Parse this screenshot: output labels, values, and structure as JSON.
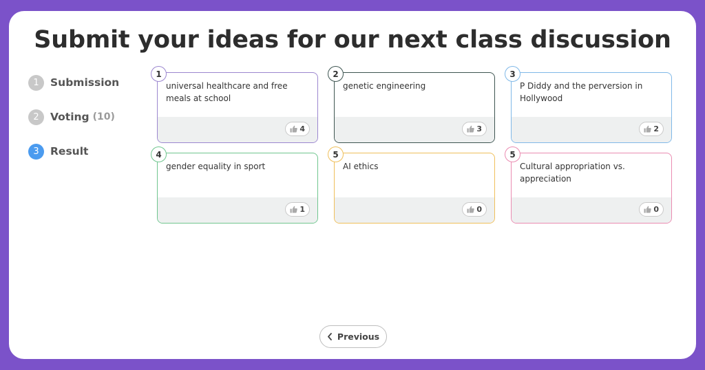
{
  "title": "Submit your ideas for our next class discussion",
  "steps": [
    {
      "num": "1",
      "label": "Submission",
      "count": "",
      "active": false
    },
    {
      "num": "2",
      "label": "Voting",
      "count": "(10)",
      "active": false
    },
    {
      "num": "3",
      "label": "Result",
      "count": "",
      "active": true
    }
  ],
  "cards": [
    {
      "rank": "1",
      "text": "universal healthcare and free meals at school",
      "votes": "4",
      "color": "#9b86cf"
    },
    {
      "rank": "2",
      "text": "genetic engineering",
      "votes": "3",
      "color": "#3d5450"
    },
    {
      "rank": "3",
      "text": "P Diddy and the perversion in Hollywood",
      "votes": "2",
      "color": "#7fb8e8"
    },
    {
      "rank": "4",
      "text": "gender equality in sport",
      "votes": "1",
      "color": "#6fc58e"
    },
    {
      "rank": "5",
      "text": "AI ethics",
      "votes": "0",
      "color": "#efbf5a"
    },
    {
      "rank": "5",
      "text": "Cultural appropriation vs. appreciation",
      "votes": "0",
      "color": "#ea8bb1"
    }
  ],
  "icons": {
    "vote": "thumbs-up-icon",
    "previous": "chevron-left-icon"
  },
  "colors": {
    "frame": "#7b52c9",
    "active_step": "#4b9bef",
    "inactive_step": "#c8c8c8"
  },
  "nav": {
    "previous_label": "Previous"
  }
}
